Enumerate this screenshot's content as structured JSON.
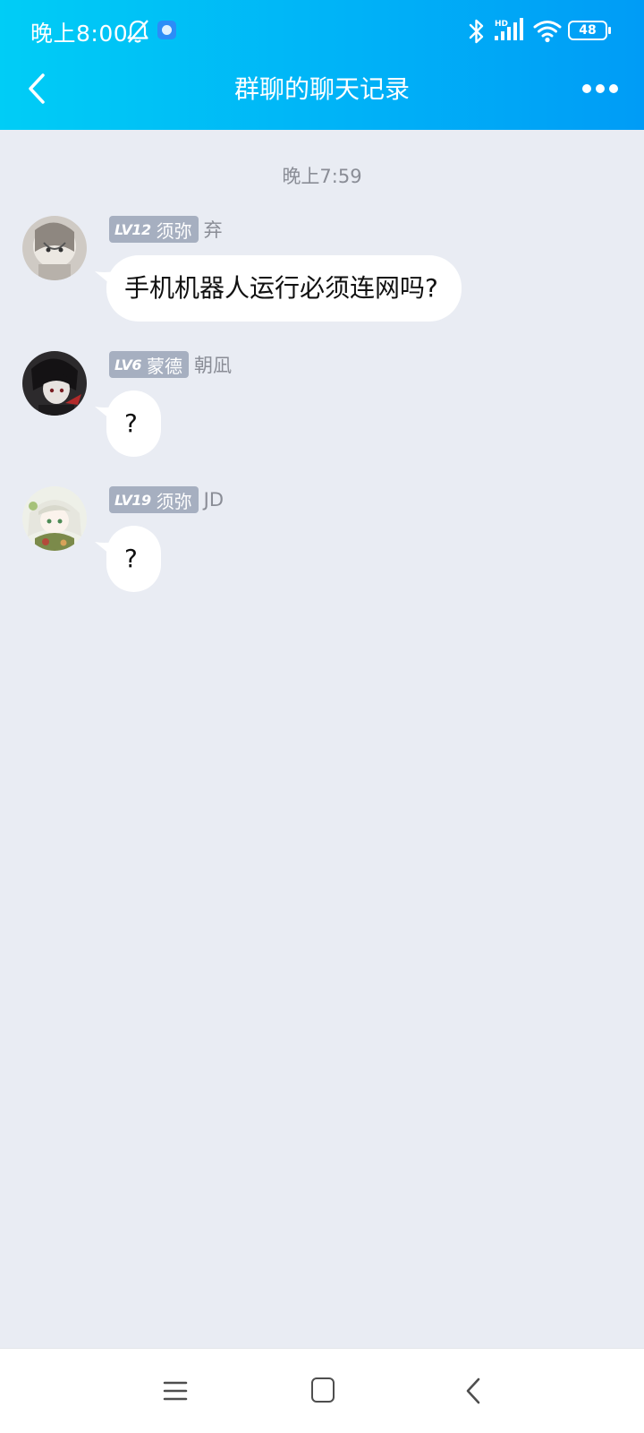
{
  "status_bar": {
    "time": "晚上8:00",
    "battery": "48",
    "icons": [
      "bell-off-icon",
      "app-notification-icon",
      "bluetooth-icon",
      "hd-signal-icon",
      "wifi-icon",
      "battery-icon"
    ]
  },
  "header": {
    "title": "群聊的聊天记录",
    "back_icon": "chevron-left-icon",
    "more_icon": "more-dots-icon",
    "gradient": [
      "#00cdf6",
      "#009cf6"
    ]
  },
  "chat": {
    "timestamp": "晚上7:59",
    "messages": [
      {
        "level": "LV12",
        "title": "须弥",
        "sender": "弃",
        "text": "手机机器人运行必须连网吗?"
      },
      {
        "level": "LV6",
        "title": "蒙德",
        "sender": "朝凪",
        "text": "?"
      },
      {
        "level": "LV19",
        "title": "须弥",
        "sender": "JD",
        "text": "?"
      }
    ]
  },
  "bottom_nav": {
    "icons": [
      "menu-icon",
      "home-icon",
      "back-icon"
    ]
  },
  "colors": {
    "background": "#e9ecf3",
    "badge": "#a6afc0",
    "bubble": "#ffffff"
  }
}
